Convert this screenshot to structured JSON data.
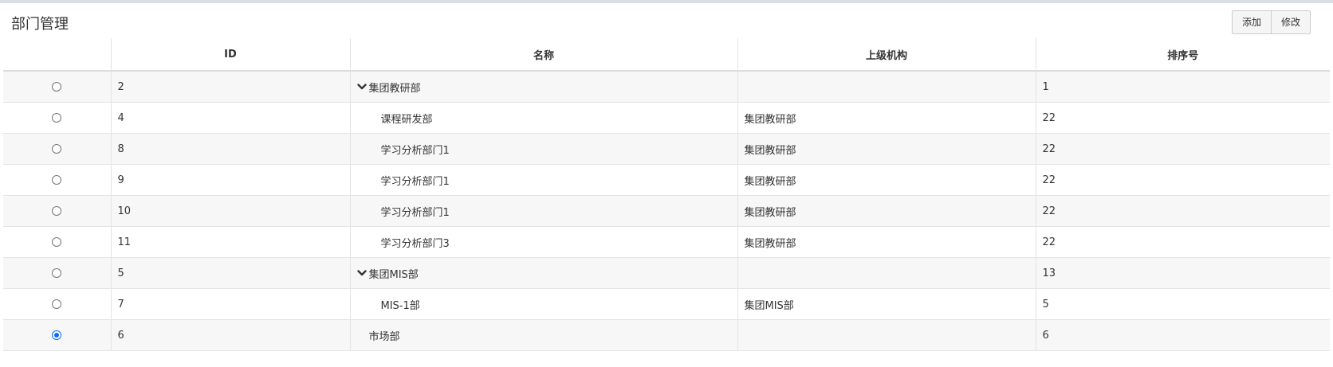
{
  "header": {
    "title": "部门管理",
    "buttons": [
      {
        "label": "添加"
      },
      {
        "label": "修改"
      }
    ]
  },
  "table": {
    "columns": [
      "",
      "ID",
      "名称",
      "上级机构",
      "排序号"
    ],
    "rows": [
      {
        "selected": false,
        "id": "2",
        "name": "集团教研部",
        "parent": "",
        "order": "1",
        "expandable": true,
        "level": 0
      },
      {
        "selected": false,
        "id": "4",
        "name": "课程研发部",
        "parent": "集团教研部",
        "order": "22",
        "expandable": false,
        "level": 1
      },
      {
        "selected": false,
        "id": "8",
        "name": "学习分析部门1",
        "parent": "集团教研部",
        "order": "22",
        "expandable": false,
        "level": 1
      },
      {
        "selected": false,
        "id": "9",
        "name": "学习分析部门1",
        "parent": "集团教研部",
        "order": "22",
        "expandable": false,
        "level": 1
      },
      {
        "selected": false,
        "id": "10",
        "name": "学习分析部门1",
        "parent": "集团教研部",
        "order": "22",
        "expandable": false,
        "level": 1
      },
      {
        "selected": false,
        "id": "11",
        "name": "学习分析部门3",
        "parent": "集团教研部",
        "order": "22",
        "expandable": false,
        "level": 1
      },
      {
        "selected": false,
        "id": "5",
        "name": "集团MIS部",
        "parent": "",
        "order": "13",
        "expandable": true,
        "level": 0
      },
      {
        "selected": false,
        "id": "7",
        "name": "MIS-1部",
        "parent": "集团MIS部",
        "order": "5",
        "expandable": false,
        "level": 1
      },
      {
        "selected": true,
        "id": "6",
        "name": "市场部",
        "parent": "",
        "order": "6",
        "expandable": false,
        "level": 0
      }
    ]
  },
  "icons": {
    "expand": "chevron-down-icon"
  },
  "colors": {
    "accent": "#0a6cff",
    "row_alt": "#f7f7f7",
    "border": "#e4e4e4"
  }
}
